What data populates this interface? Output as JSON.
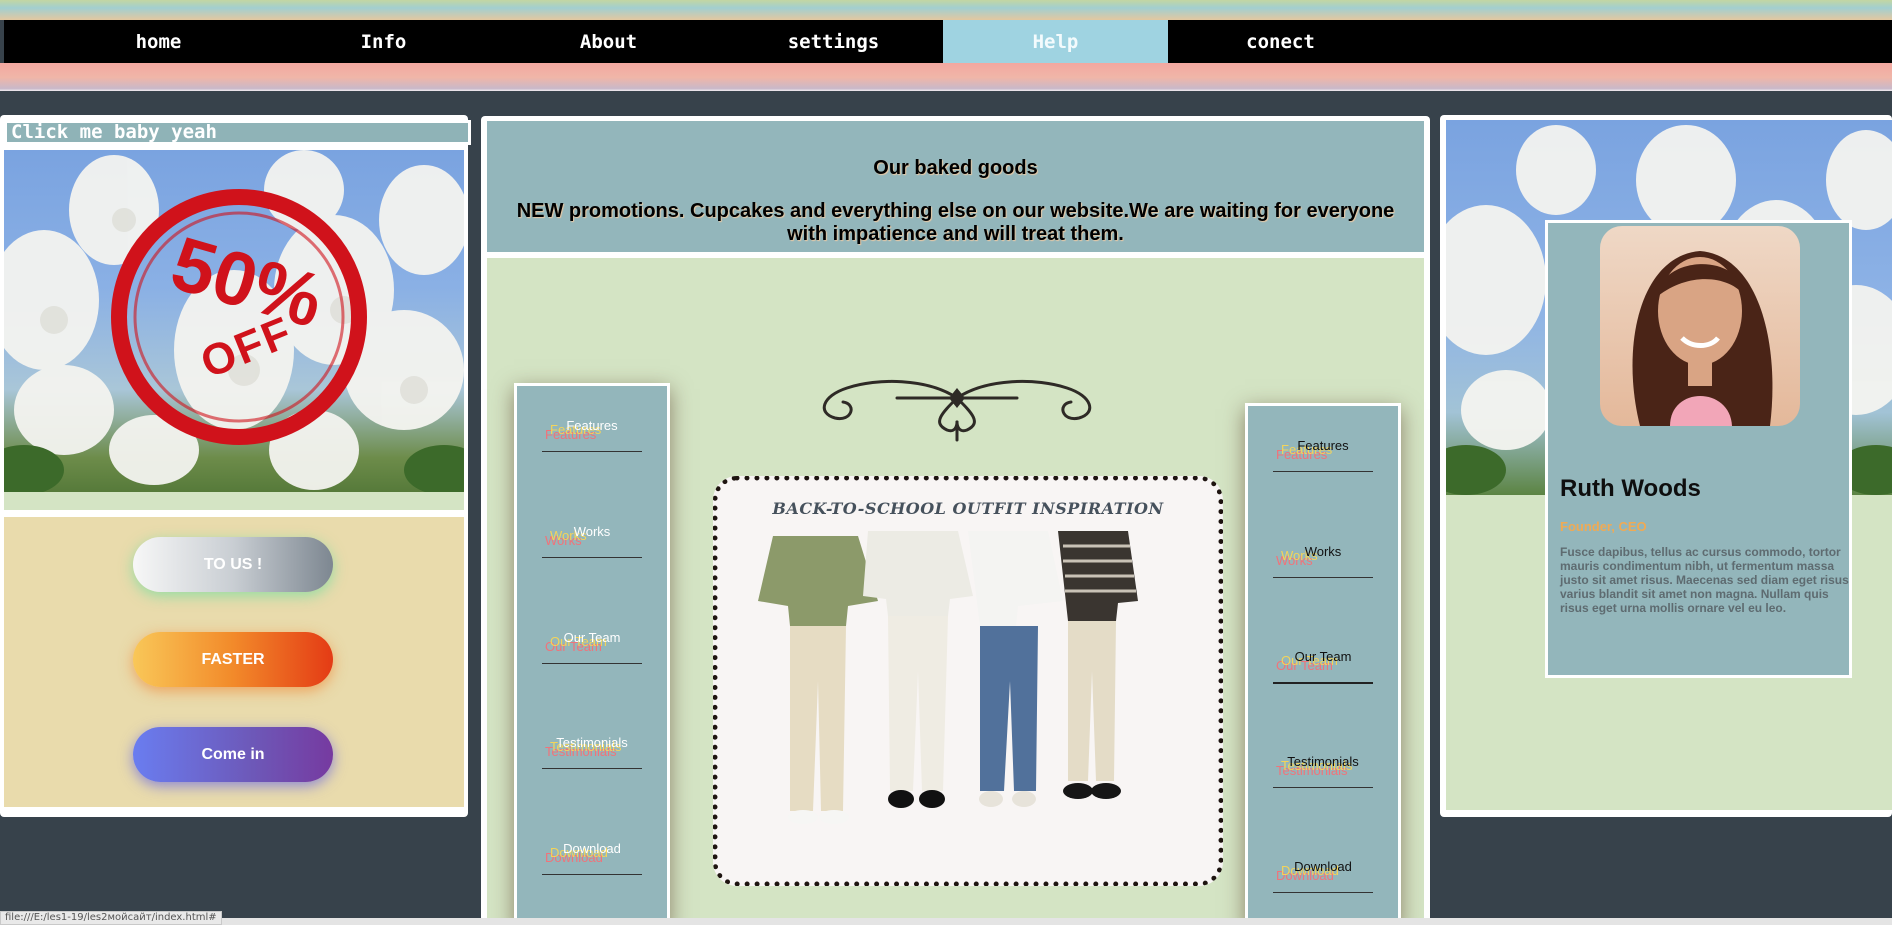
{
  "nav": {
    "items": [
      {
        "label": "home"
      },
      {
        "label": "Info"
      },
      {
        "label": "About"
      },
      {
        "label": "settings"
      },
      {
        "label": "Help"
      },
      {
        "label": "conect"
      }
    ],
    "active_index": 4,
    "active_color": "#9fd3e1"
  },
  "left": {
    "click_label": "Click me baby yeah",
    "promo_stamp": {
      "percent": "50%",
      "word": "OFF"
    },
    "buttons": {
      "tous": "TO US !",
      "faster": "FASTER",
      "come_in": "Come in"
    }
  },
  "center": {
    "title": "Our baked goods",
    "promo_text": "NEW promotions. Cupcakes and everything else on our website.We are waiting for everyone with impatience and will treat them.",
    "outfit_title": "BACK-TO-SCHOOL OUTFIT INSPIRATION",
    "menu": [
      "Features",
      "Works",
      "Our Team",
      "Testimonials",
      "Download"
    ]
  },
  "profile": {
    "name": "Ruth Woods",
    "role": "Founder, CEO",
    "bio": "Fusce dapibus, tellus ac cursus commodo, tortor mauris condimentum nibh, ut fermentum massa justo sit amet risus. Maecenas sed diam eget risus varius blandit sit amet non magna. Nullam quis risus eget urna mollis ornare vel eu leo."
  },
  "statusbar": {
    "url": "file:///E:/les1-19/les2мойсайт/index.html#"
  },
  "colors": {
    "panel_blue": "#93b6bb",
    "panel_green": "#d4e4c4",
    "panel_sand": "#e9dbac",
    "background": "#37424b"
  }
}
